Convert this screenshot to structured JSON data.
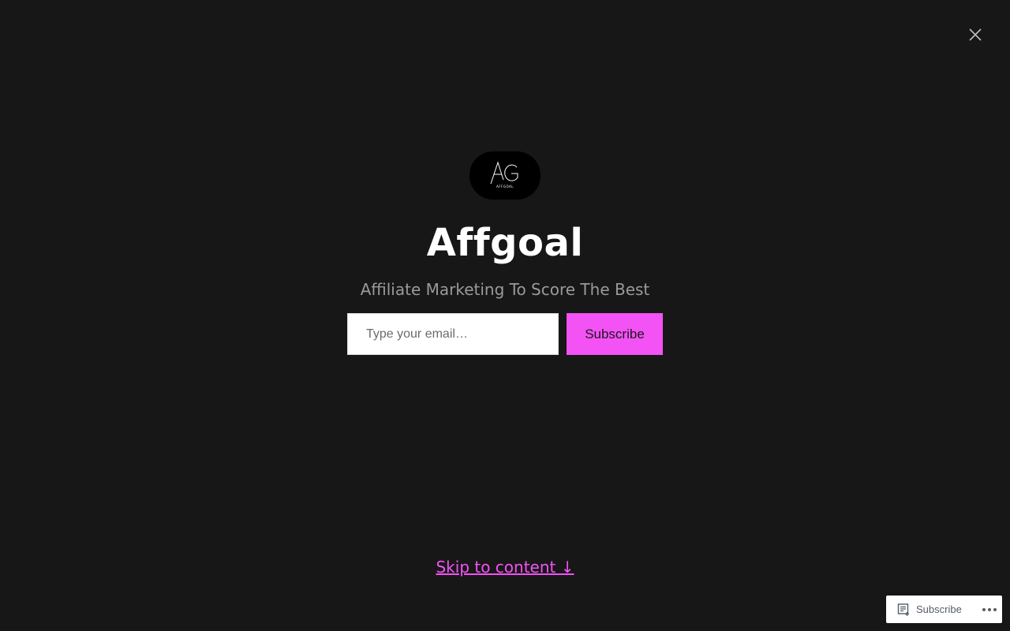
{
  "colors": {
    "background": "#171717",
    "accent": "#f352f5",
    "title": "#ffffff",
    "tagline": "#9a9a9a"
  },
  "header": {
    "close_icon": "close-icon"
  },
  "logo": {
    "caption": "AFFGOAL"
  },
  "site": {
    "title": "Affgoal",
    "tagline": "Affiliate Marketing To Score The Best"
  },
  "form": {
    "email_placeholder": "Type your email…",
    "email_value": "",
    "subscribe_label": "Subscribe"
  },
  "skip_link": {
    "label": "Skip to content ↓"
  },
  "bottom_bar": {
    "subscribe_icon": "reader-icon",
    "subscribe_label": "Subscribe",
    "more_icon": "ellipsis-icon"
  }
}
